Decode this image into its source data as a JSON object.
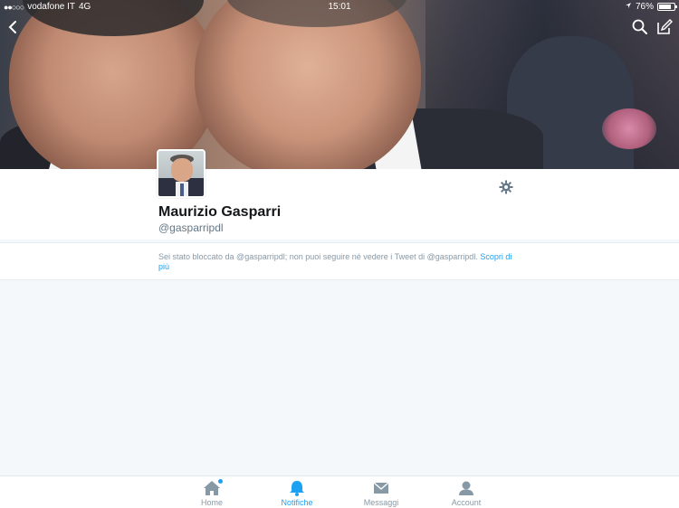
{
  "status_bar": {
    "carrier": "vodafone IT",
    "network": "4G",
    "time": "15:01",
    "battery": "76%"
  },
  "header": {
    "back_icon": "chevron-left-icon",
    "search_icon": "search-icon",
    "compose_icon": "compose-icon"
  },
  "profile": {
    "name": "Maurizio Gasparri",
    "handle": "@gasparripdl",
    "settings_icon": "gear-icon"
  },
  "notice": {
    "text": "Sei stato bloccato da @gasparripdl; non puoi seguire né vedere i Tweet di @gasparripdl.",
    "link": "Scopri di più"
  },
  "tabs": [
    {
      "label": "Home",
      "icon": "home-icon",
      "active": false,
      "badge": true
    },
    {
      "label": "Notifiche",
      "icon": "bell-icon",
      "active": true,
      "badge": false
    },
    {
      "label": "Messaggi",
      "icon": "envelope-icon",
      "active": false,
      "badge": false
    },
    {
      "label": "Account",
      "icon": "person-icon",
      "active": false,
      "badge": false
    }
  ],
  "colors": {
    "accent": "#1da1f2",
    "muted": "#8899a6",
    "background": "#f5f8fa"
  }
}
